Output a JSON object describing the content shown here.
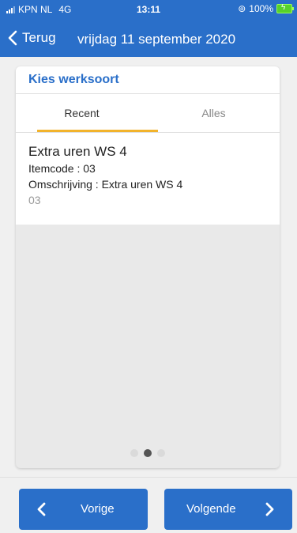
{
  "status_bar": {
    "carrier": "KPN NL",
    "network": "4G",
    "time": "13:11",
    "battery": "100%"
  },
  "nav": {
    "back_label": "Terug",
    "title": "vrijdag 11 september 2020"
  },
  "card": {
    "header": "Kies werksoort",
    "tabs": [
      {
        "label": "Recent",
        "active": true
      },
      {
        "label": "Alles",
        "active": false
      }
    ],
    "items": [
      {
        "title": "Extra uren WS 4",
        "itemcode_line": "Itemcode : 03",
        "description_line": "Omschrijving : Extra uren WS 4",
        "code": "03"
      }
    ],
    "pager": {
      "pages": 3,
      "current": 2
    }
  },
  "footer": {
    "prev_label": "Vorige",
    "next_label": "Volgende"
  },
  "colors": {
    "primary": "#2a6fc9",
    "tab_indicator": "#f2b32b",
    "battery": "#57d12b"
  }
}
